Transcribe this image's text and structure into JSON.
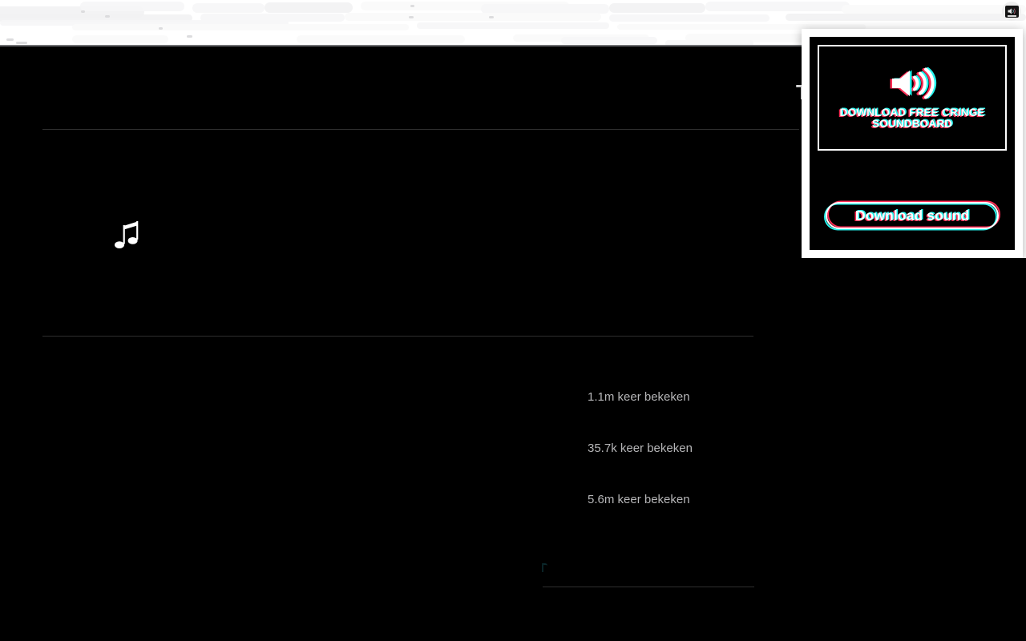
{
  "browser": {
    "extension_button_icon": "soundboard-speaker-icon"
  },
  "page": {
    "wordmark": "T",
    "menu_icon": "hamburger-menu-icon",
    "music_icon": "music-note-icon",
    "views": [
      {
        "count": "1.1m keer bekeken"
      },
      {
        "count": "35.7k keer bekeken"
      },
      {
        "count": "5.6m keer bekeken"
      }
    ]
  },
  "popup": {
    "hero": {
      "icon": "speaker-waves-icon",
      "title": "DOWNLOAD FREE CRINGE SOUNDBOARD"
    },
    "cta_label": "Download sound",
    "colors": {
      "red": "#fe2c55",
      "cyan": "#25f4ee",
      "white": "#ffffff",
      "background": "#000000"
    }
  }
}
